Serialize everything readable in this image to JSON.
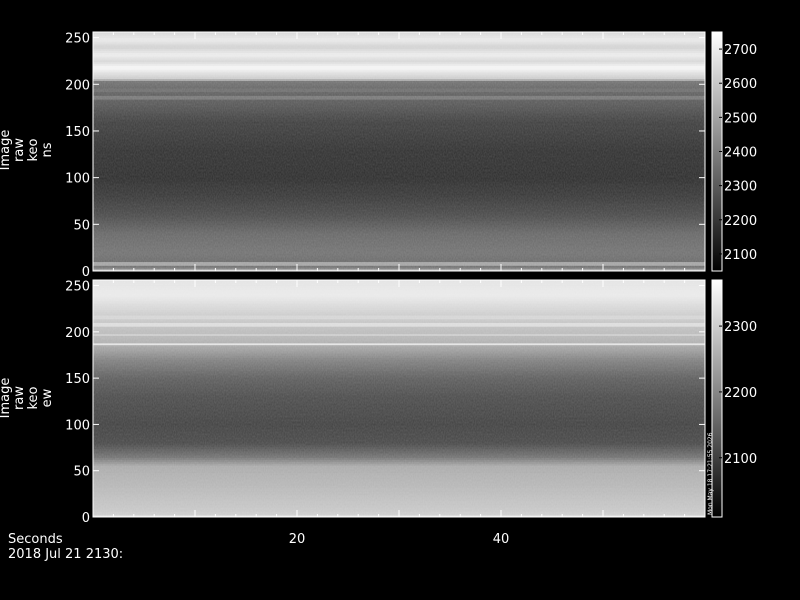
{
  "chart_data": [
    {
      "type": "heatmap",
      "ylabel_lines": [
        "Image",
        "raw",
        "keo",
        "ns"
      ],
      "y_ticks": [
        0,
        50,
        100,
        150,
        200,
        250
      ],
      "ylim": [
        0,
        256
      ],
      "xlim": [
        0,
        60
      ],
      "x_ticks": [
        20,
        40
      ],
      "colorbar": {
        "ticks": [
          2100,
          2200,
          2300,
          2400,
          2500,
          2600,
          2700
        ],
        "range": [
          2050,
          2750
        ]
      },
      "profile": [
        [
          0,
          2680
        ],
        [
          3,
          2400
        ],
        [
          6,
          2330
        ],
        [
          20,
          2360
        ],
        [
          40,
          2330
        ],
        [
          60,
          2250
        ],
        [
          80,
          2200
        ],
        [
          100,
          2170
        ],
        [
          130,
          2180
        ],
        [
          160,
          2220
        ],
        [
          180,
          2290
        ],
        [
          195,
          2320
        ],
        [
          203,
          2360
        ],
        [
          206,
          2600
        ],
        [
          212,
          2660
        ],
        [
          218,
          2730
        ],
        [
          225,
          2640
        ],
        [
          232,
          2700
        ],
        [
          240,
          2620
        ],
        [
          248,
          2690
        ],
        [
          256,
          2640
        ]
      ],
      "stripes": [
        [
          8,
          2500
        ],
        [
          186,
          2380
        ],
        [
          194,
          2350
        ]
      ]
    },
    {
      "type": "heatmap",
      "ylabel_lines": [
        "Image",
        "raw",
        "keo",
        "ew"
      ],
      "y_ticks": [
        0,
        50,
        100,
        150,
        200,
        250
      ],
      "ylim": [
        0,
        256
      ],
      "xlim": [
        0,
        60
      ],
      "x_ticks": [
        20,
        40
      ],
      "colorbar": {
        "ticks": [
          2100,
          2200,
          2300
        ],
        "range": [
          2010,
          2370
        ]
      },
      "colorbar_side_label": "Mon May 18 17:21:55 2026",
      "profile": [
        [
          0,
          2360
        ],
        [
          3,
          2300
        ],
        [
          8,
          2290
        ],
        [
          30,
          2270
        ],
        [
          55,
          2250
        ],
        [
          65,
          2170
        ],
        [
          80,
          2110
        ],
        [
          100,
          2100
        ],
        [
          130,
          2115
        ],
        [
          150,
          2140
        ],
        [
          170,
          2190
        ],
        [
          180,
          2230
        ],
        [
          190,
          2260
        ],
        [
          205,
          2280
        ],
        [
          220,
          2300
        ],
        [
          240,
          2340
        ],
        [
          256,
          2330
        ]
      ],
      "stripes": [
        [
          187,
          2330
        ],
        [
          197,
          2300
        ],
        [
          208,
          2320
        ],
        [
          216,
          2310
        ]
      ]
    }
  ],
  "footer": {
    "axis_name": "Seconds",
    "date_label": "2018 Jul 21 2130:"
  }
}
